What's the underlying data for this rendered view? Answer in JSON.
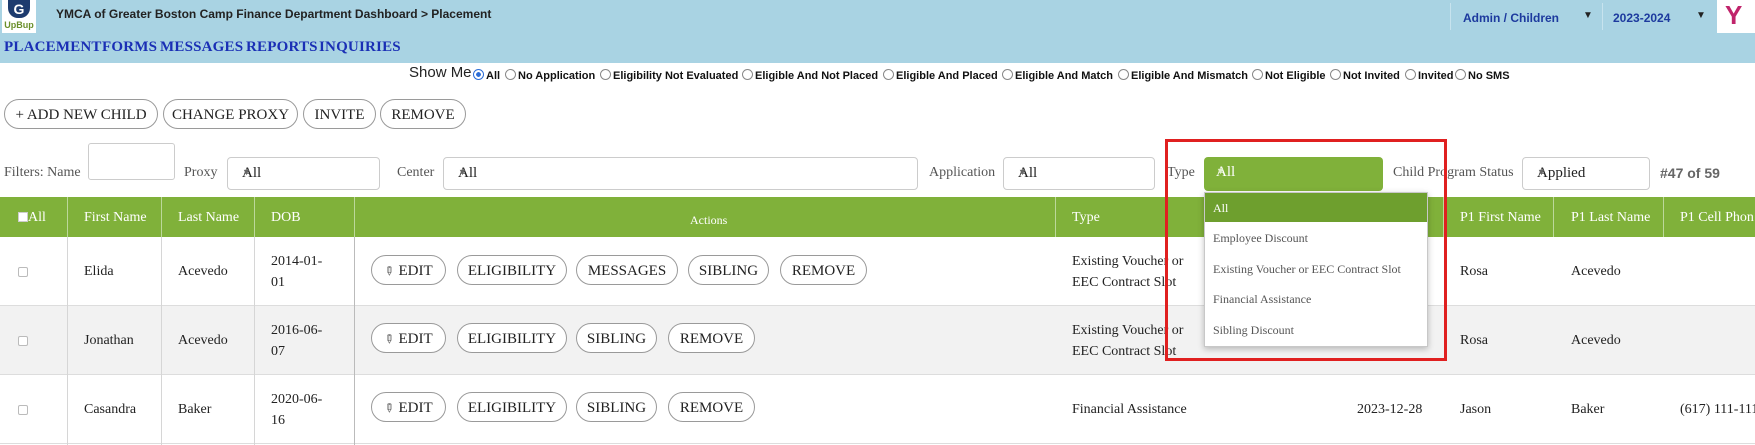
{
  "header": {
    "app_title": "YMCA of Greater Boston Camp Finance Department Dashboard > Placement",
    "logo_text": "UpBup",
    "role_select": "Admin / Children",
    "year_select": "2023-2024",
    "brand_color": "#a9d3e3",
    "accent_color": "#80b13a"
  },
  "nav": {
    "items": [
      "PLACEMENT",
      "FORMS",
      "MESSAGES",
      "REPORTS",
      "INQUIRIES"
    ]
  },
  "show_me": {
    "label": "Show Me",
    "selected": "All",
    "options": [
      "All",
      "No Application",
      "Eligibility Not Evaluated",
      "Eligible And Not Placed",
      "Eligible And Placed",
      "Eligible And Match",
      "Eligible And Mismatch",
      "Not Eligible",
      "Not Invited",
      "Invited",
      "No SMS"
    ]
  },
  "actions": {
    "add_new_child": "ADD NEW CHILD",
    "change_proxy": "CHANGE PROXY",
    "invite": "INVITE",
    "remove": "REMOVE"
  },
  "filters": {
    "name_label": "Filters: Name",
    "proxy_label": "Proxy",
    "proxy_value": "All",
    "center_label": "Center",
    "center_value": "All",
    "application_label": "Application",
    "application_value": "All",
    "type_label": "Type",
    "type_value": "All",
    "child_program_status_label": "Child Program Status",
    "child_program_status_value": "Applied",
    "record_count": "#47 of 59"
  },
  "type_dropdown": {
    "options": [
      "All",
      "Employee Discount",
      "Existing Voucher or EEC Contract Slot",
      "Financial Assistance",
      "Sibling Discount"
    ],
    "selected": "All"
  },
  "table": {
    "columns": {
      "select_all": "All",
      "first_name": "First Name",
      "last_name": "Last Name",
      "dob": "DOB",
      "actions": "Actions",
      "type": "Type",
      "p1_first_name": "P1 First Name",
      "p1_last_name": "P1 Last Name",
      "p1_cell_phone": "P1 Cell Phon"
    },
    "action_labels": {
      "edit": "EDIT",
      "eligibility": "ELIGIBILITY",
      "messages": "MESSAGES",
      "sibling": "SIBLING",
      "remove": "REMOVE"
    },
    "rows": [
      {
        "first": "Elida",
        "last": "Acevedo",
        "dob_1": "2014-01-",
        "dob_2": "01",
        "type_1": "Existing Voucher or",
        "type_2": "EEC Contract Slot",
        "date": "",
        "p1_first": "Rosa",
        "p1_last": "Acevedo",
        "p1_phone": ""
      },
      {
        "first": "Jonathan",
        "last": "Acevedo",
        "dob_1": "2016-06-",
        "dob_2": "07",
        "type_1": "Existing Voucher or",
        "type_2": "EEC Contract Slot",
        "date": "",
        "p1_first": "Rosa",
        "p1_last": "Acevedo",
        "p1_phone": ""
      },
      {
        "first": "Casandra",
        "last": "Baker",
        "dob_1": "2020-06-",
        "dob_2": "16",
        "type_1": "Financial Assistance",
        "type_2": "",
        "date": "2023-12-28",
        "p1_first": "Jason",
        "p1_last": "Baker",
        "p1_phone": "(617) 111-111"
      }
    ]
  }
}
